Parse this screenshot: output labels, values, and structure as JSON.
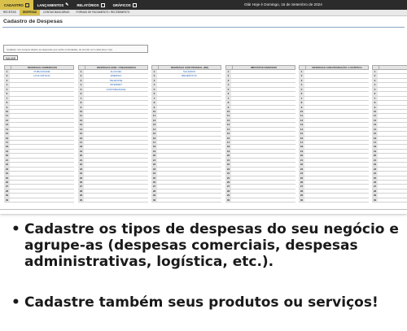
{
  "menu": {
    "items": [
      {
        "label": "CADASTRO",
        "icon": "form-icon",
        "active": true
      },
      {
        "label": "LANÇAMENTOS",
        "icon": "pencil-icon",
        "active": false
      },
      {
        "label": "RELATÓRIOS",
        "icon": "report-icon",
        "active": false
      },
      {
        "label": "GRÁFICOS",
        "icon": "chart-icon",
        "active": false
      }
    ],
    "greeting": "Olá! Hoje é Domingo, 15 de Setembro de 2024"
  },
  "submenu": {
    "items": [
      {
        "label": "RECEITAS",
        "active": false
      },
      {
        "label": "DESPESAS",
        "active": true
      },
      {
        "label": "CONTAS BANCÁRIAS",
        "active": false
      },
      {
        "label": "FORMAS DE PAGAMENTO / RECEBIMENTO",
        "active": false
      }
    ]
  },
  "page": {
    "title": "Cadastro de Despesas",
    "instruction": "Cadastre nos campos abaixo as despesas que serão controladas, de acordo com cada área / tipo.",
    "save_label": "SALVAR"
  },
  "tables": [
    {
      "header": "DESPESAS COMERCIAIS",
      "entries": [
        "PUBLICIDADE",
        "LOJA VIRTUAL"
      ]
    },
    {
      "header": "DESPESAS ADM. / FINANCEIRAS",
      "entries": [
        "ALUGUEL",
        "ENERGIA",
        "TELEFONE",
        "INTERNET",
        "CONTABILIDADE"
      ]
    },
    {
      "header": "DESPESAS COM PESSOAL (RH)",
      "entries": [
        "SALÁRIOS",
        "BENEFÍCIOS"
      ]
    },
    {
      "header": "IMPOSTOS DIVERSOS",
      "entries": []
    },
    {
      "header": "DESPESAS COM PRODUÇÃO / LOGÍSTICA",
      "entries": []
    },
    {
      "header": "D",
      "entries": []
    }
  ],
  "row_count": 30,
  "colors": {
    "menu_bg": "#2b2b2b",
    "accent": "#d9c04a",
    "link_blue": "#1f5fbf"
  },
  "bullets": [
    "Cadastre os tipos de despesas do seu negócio e agrupe-as (despesas comerciais, despesas administrativas, logística, etc.).",
    "Cadastre também seus produtos ou serviços!"
  ]
}
